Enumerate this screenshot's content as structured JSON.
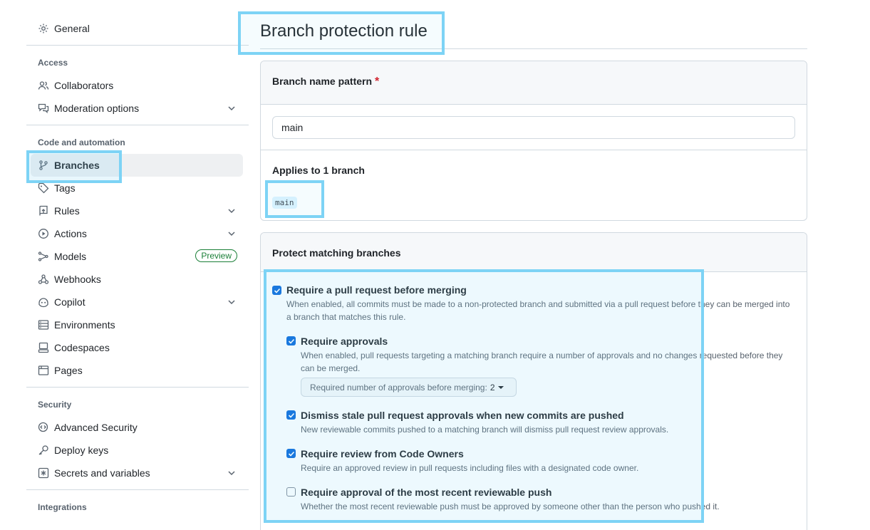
{
  "sidebar": {
    "general": "General",
    "access_title": "Access",
    "collaborators": "Collaborators",
    "moderation": "Moderation options",
    "code_title": "Code and automation",
    "branches": "Branches",
    "tags": "Tags",
    "rules": "Rules",
    "actions": "Actions",
    "models": "Models",
    "preview_badge": "Preview",
    "webhooks": "Webhooks",
    "copilot": "Copilot",
    "environments": "Environments",
    "codespaces": "Codespaces",
    "pages": "Pages",
    "security_title": "Security",
    "advanced_security": "Advanced Security",
    "deploy_keys": "Deploy keys",
    "secrets": "Secrets and variables",
    "integrations_title": "Integrations"
  },
  "main": {
    "title": "Branch protection rule",
    "pattern_label": "Branch name pattern",
    "pattern_required": "*",
    "pattern_value": "main",
    "applies_label": "Applies to 1 branch",
    "applies_branch": "main",
    "protect_title": "Protect matching branches",
    "options": [
      {
        "title": "Require a pull request before merging",
        "desc": "When enabled, all commits must be made to a non-protected branch and submitted via a pull request before they can be merged into a branch that matches this rule.",
        "checked": true
      },
      {
        "title": "Require approvals",
        "desc": "When enabled, pull requests targeting a matching branch require a number of approvals and no changes requested before they can be merged.",
        "checked": true
      },
      {
        "title": "Dismiss stale pull request approvals when new commits are pushed",
        "desc": "New reviewable commits pushed to a matching branch will dismiss pull request review approvals.",
        "checked": true
      },
      {
        "title": "Require review from Code Owners",
        "desc": "Require an approved review in pull requests including files with a designated code owner.",
        "checked": true
      },
      {
        "title": "Require approval of the most recent reviewable push",
        "desc": "Whether the most recent reviewable push must be approved by someone other than the person who pushed it.",
        "checked": false
      }
    ],
    "approvals_select_label": "Required number of approvals before merging:",
    "approvals_select_value": "2"
  },
  "colors": {
    "accent": "#0969da",
    "highlight": "#7dd3f5",
    "preview_green": "#1a7f37",
    "required_red": "#d1242f"
  }
}
